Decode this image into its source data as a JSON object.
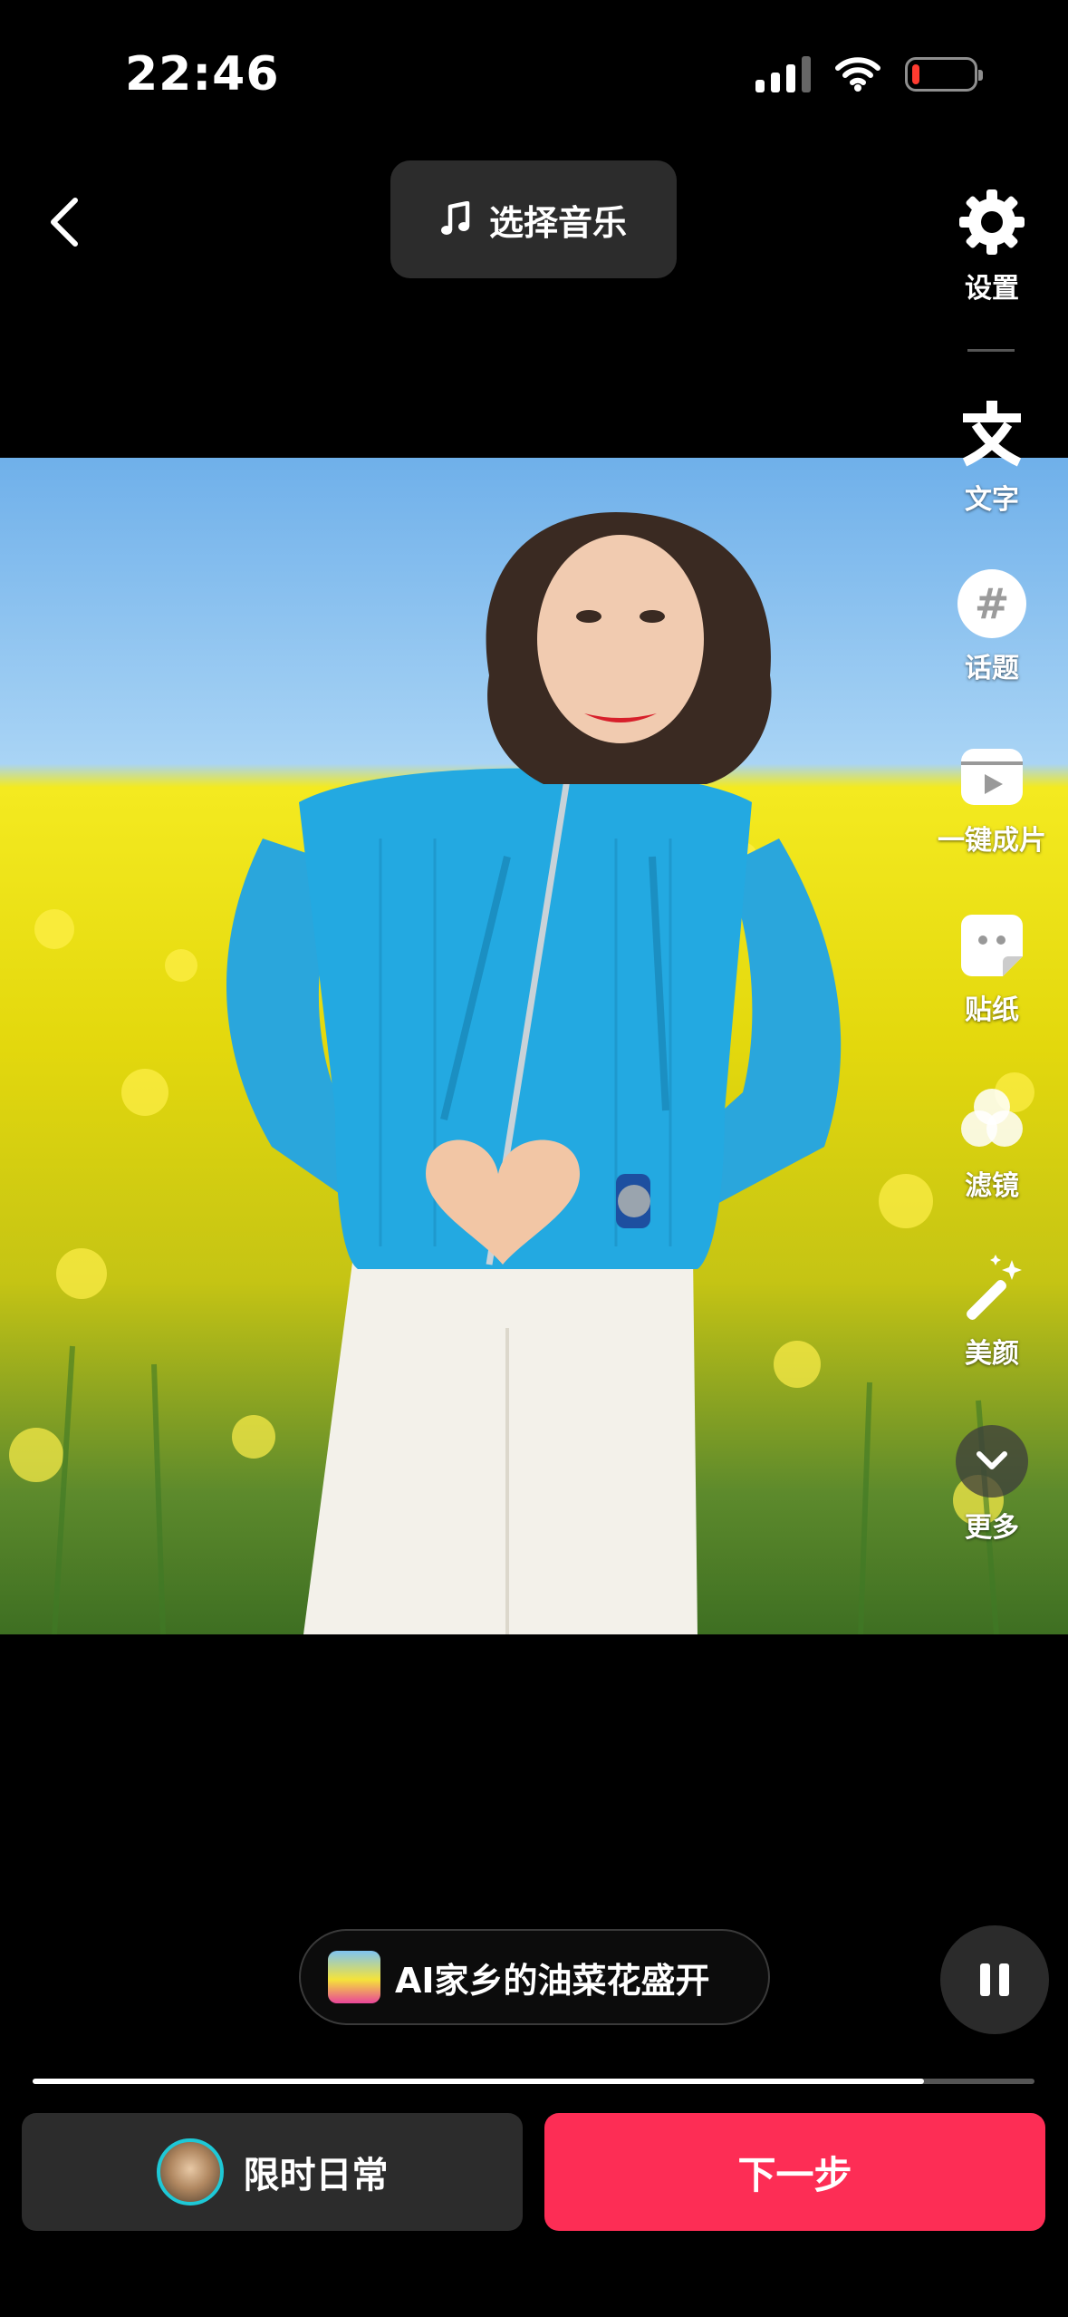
{
  "status_bar": {
    "time": "22:46",
    "battery_level": 0.12
  },
  "header": {
    "music_label": "选择音乐"
  },
  "toolbar": {
    "settings": "设置",
    "text": "文字",
    "topic": "话题",
    "one_click": "一键成片",
    "sticker": "贴纸",
    "filter": "滤镜",
    "beauty": "美颜",
    "more": "更多"
  },
  "template": {
    "label": "AI家乡的油菜花盛开"
  },
  "playback": {
    "progress": 0.89
  },
  "bottom": {
    "daily_label": "限时日常",
    "next_label": "下一步"
  },
  "colors": {
    "accent": "#fd2d55",
    "ring": "#1ec8d6"
  }
}
